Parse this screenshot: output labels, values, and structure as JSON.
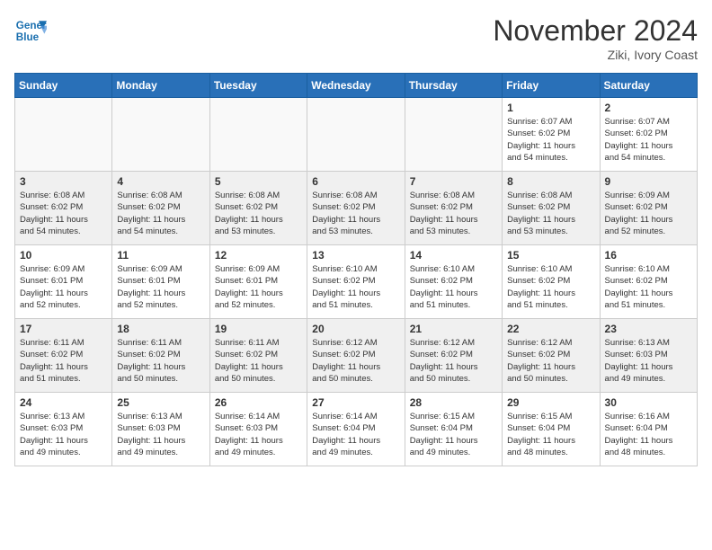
{
  "header": {
    "logo_line1": "General",
    "logo_line2": "Blue",
    "month": "November 2024",
    "location": "Ziki, Ivory Coast"
  },
  "weekdays": [
    "Sunday",
    "Monday",
    "Tuesday",
    "Wednesday",
    "Thursday",
    "Friday",
    "Saturday"
  ],
  "weeks": [
    [
      {
        "day": "",
        "info": ""
      },
      {
        "day": "",
        "info": ""
      },
      {
        "day": "",
        "info": ""
      },
      {
        "day": "",
        "info": ""
      },
      {
        "day": "",
        "info": ""
      },
      {
        "day": "1",
        "info": "Sunrise: 6:07 AM\nSunset: 6:02 PM\nDaylight: 11 hours\nand 54 minutes."
      },
      {
        "day": "2",
        "info": "Sunrise: 6:07 AM\nSunset: 6:02 PM\nDaylight: 11 hours\nand 54 minutes."
      }
    ],
    [
      {
        "day": "3",
        "info": "Sunrise: 6:08 AM\nSunset: 6:02 PM\nDaylight: 11 hours\nand 54 minutes."
      },
      {
        "day": "4",
        "info": "Sunrise: 6:08 AM\nSunset: 6:02 PM\nDaylight: 11 hours\nand 54 minutes."
      },
      {
        "day": "5",
        "info": "Sunrise: 6:08 AM\nSunset: 6:02 PM\nDaylight: 11 hours\nand 53 minutes."
      },
      {
        "day": "6",
        "info": "Sunrise: 6:08 AM\nSunset: 6:02 PM\nDaylight: 11 hours\nand 53 minutes."
      },
      {
        "day": "7",
        "info": "Sunrise: 6:08 AM\nSunset: 6:02 PM\nDaylight: 11 hours\nand 53 minutes."
      },
      {
        "day": "8",
        "info": "Sunrise: 6:08 AM\nSunset: 6:02 PM\nDaylight: 11 hours\nand 53 minutes."
      },
      {
        "day": "9",
        "info": "Sunrise: 6:09 AM\nSunset: 6:02 PM\nDaylight: 11 hours\nand 52 minutes."
      }
    ],
    [
      {
        "day": "10",
        "info": "Sunrise: 6:09 AM\nSunset: 6:01 PM\nDaylight: 11 hours\nand 52 minutes."
      },
      {
        "day": "11",
        "info": "Sunrise: 6:09 AM\nSunset: 6:01 PM\nDaylight: 11 hours\nand 52 minutes."
      },
      {
        "day": "12",
        "info": "Sunrise: 6:09 AM\nSunset: 6:01 PM\nDaylight: 11 hours\nand 52 minutes."
      },
      {
        "day": "13",
        "info": "Sunrise: 6:10 AM\nSunset: 6:02 PM\nDaylight: 11 hours\nand 51 minutes."
      },
      {
        "day": "14",
        "info": "Sunrise: 6:10 AM\nSunset: 6:02 PM\nDaylight: 11 hours\nand 51 minutes."
      },
      {
        "day": "15",
        "info": "Sunrise: 6:10 AM\nSunset: 6:02 PM\nDaylight: 11 hours\nand 51 minutes."
      },
      {
        "day": "16",
        "info": "Sunrise: 6:10 AM\nSunset: 6:02 PM\nDaylight: 11 hours\nand 51 minutes."
      }
    ],
    [
      {
        "day": "17",
        "info": "Sunrise: 6:11 AM\nSunset: 6:02 PM\nDaylight: 11 hours\nand 51 minutes."
      },
      {
        "day": "18",
        "info": "Sunrise: 6:11 AM\nSunset: 6:02 PM\nDaylight: 11 hours\nand 50 minutes."
      },
      {
        "day": "19",
        "info": "Sunrise: 6:11 AM\nSunset: 6:02 PM\nDaylight: 11 hours\nand 50 minutes."
      },
      {
        "day": "20",
        "info": "Sunrise: 6:12 AM\nSunset: 6:02 PM\nDaylight: 11 hours\nand 50 minutes."
      },
      {
        "day": "21",
        "info": "Sunrise: 6:12 AM\nSunset: 6:02 PM\nDaylight: 11 hours\nand 50 minutes."
      },
      {
        "day": "22",
        "info": "Sunrise: 6:12 AM\nSunset: 6:02 PM\nDaylight: 11 hours\nand 50 minutes."
      },
      {
        "day": "23",
        "info": "Sunrise: 6:13 AM\nSunset: 6:03 PM\nDaylight: 11 hours\nand 49 minutes."
      }
    ],
    [
      {
        "day": "24",
        "info": "Sunrise: 6:13 AM\nSunset: 6:03 PM\nDaylight: 11 hours\nand 49 minutes."
      },
      {
        "day": "25",
        "info": "Sunrise: 6:13 AM\nSunset: 6:03 PM\nDaylight: 11 hours\nand 49 minutes."
      },
      {
        "day": "26",
        "info": "Sunrise: 6:14 AM\nSunset: 6:03 PM\nDaylight: 11 hours\nand 49 minutes."
      },
      {
        "day": "27",
        "info": "Sunrise: 6:14 AM\nSunset: 6:04 PM\nDaylight: 11 hours\nand 49 minutes."
      },
      {
        "day": "28",
        "info": "Sunrise: 6:15 AM\nSunset: 6:04 PM\nDaylight: 11 hours\nand 49 minutes."
      },
      {
        "day": "29",
        "info": "Sunrise: 6:15 AM\nSunset: 6:04 PM\nDaylight: 11 hours\nand 48 minutes."
      },
      {
        "day": "30",
        "info": "Sunrise: 6:16 AM\nSunset: 6:04 PM\nDaylight: 11 hours\nand 48 minutes."
      }
    ]
  ]
}
